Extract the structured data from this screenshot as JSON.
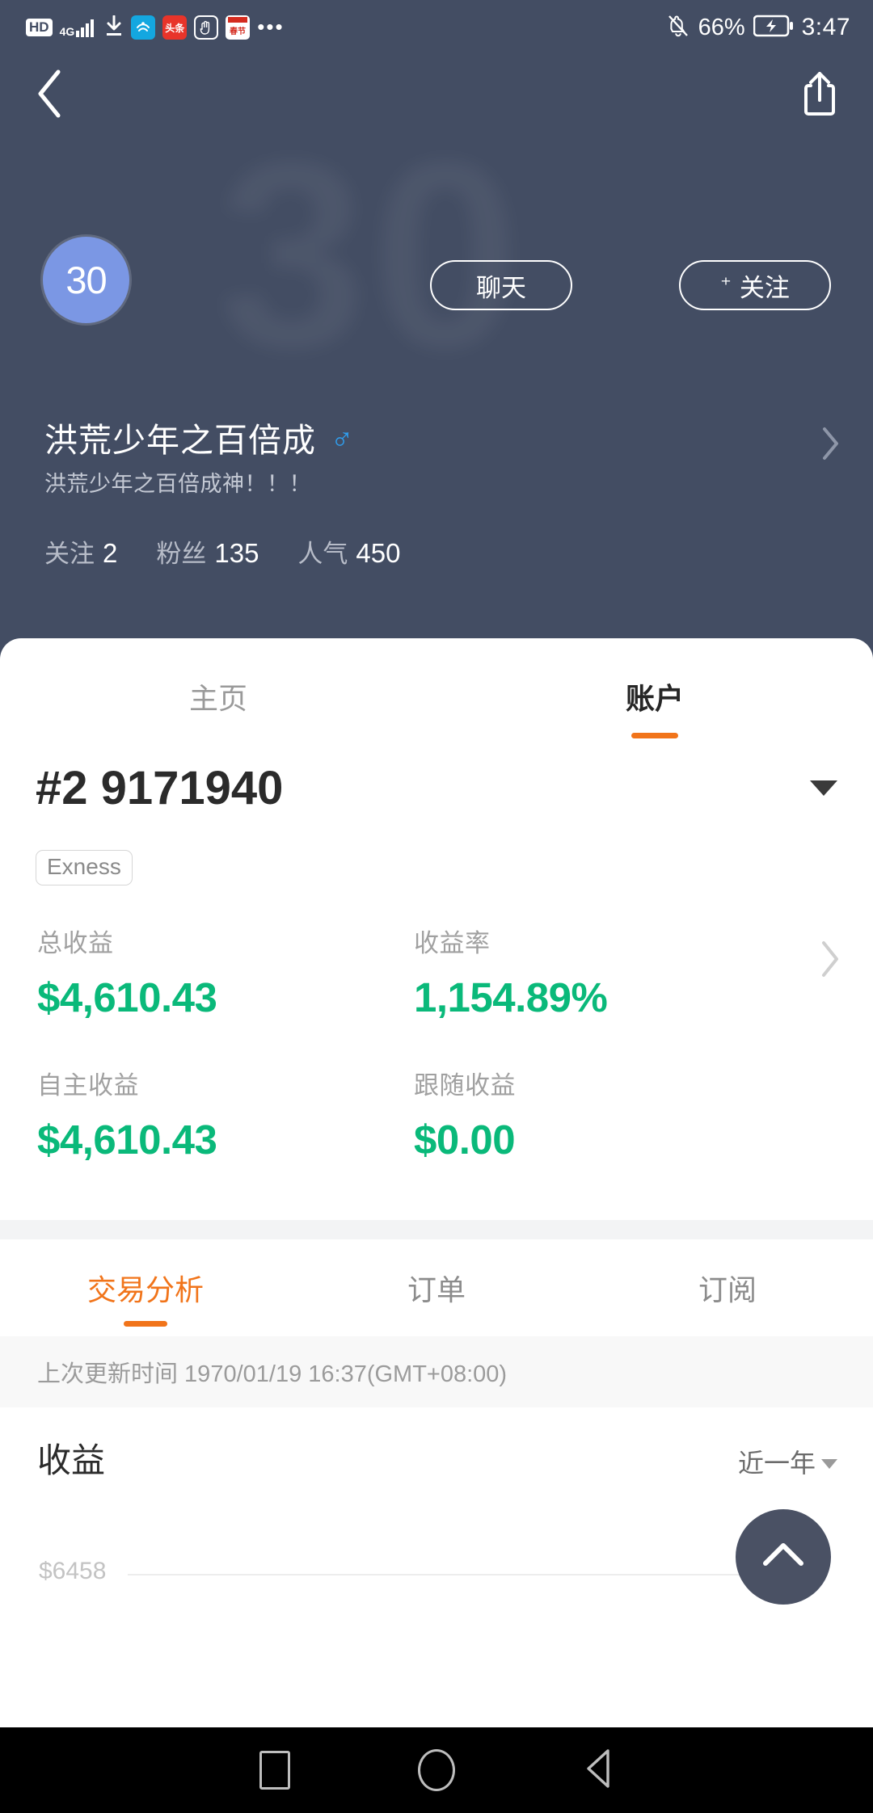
{
  "status_bar": {
    "hd_badge": "HD",
    "network": "4G",
    "icons": [
      "hd-badge",
      "signal-4g-icon",
      "download-icon",
      "app-alipay-icon",
      "app-toutiao-icon",
      "app-gesture-icon",
      "app-calendar-icon",
      "more-icon"
    ],
    "more": "•••",
    "mute_icon": "bell-muted-icon",
    "battery_percent": "66%",
    "battery_icon": "battery-charging-icon",
    "time": "3:47"
  },
  "topnav": {
    "back_icon": "back-chevron-icon",
    "share_icon": "share-icon"
  },
  "profile": {
    "avatar_label": "30",
    "watermark": "30",
    "chat_button": "聊天",
    "follow_button": "关注",
    "follow_plus": "⁺",
    "display_name": "洪荒少年之百倍成",
    "gender_icon": "♂",
    "bio": "洪荒少年之百倍成神！！！",
    "stats": [
      {
        "label": "关注",
        "value": "2"
      },
      {
        "label": "粉丝",
        "value": "135"
      },
      {
        "label": "人气",
        "value": "450"
      }
    ]
  },
  "profile_tabs": [
    {
      "label": "主页",
      "active": false
    },
    {
      "label": "账户",
      "active": true
    }
  ],
  "account": {
    "number": "#2 9171940",
    "dropdown_icon": "chevron-down-icon",
    "broker_badge": "Exness",
    "detail_chevron_icon": "chevron-right-icon",
    "metrics": [
      {
        "label": "总收益",
        "value": "$4,610.43"
      },
      {
        "label": "收益率",
        "value": "1,154.89%"
      },
      {
        "label": "自主收益",
        "value": "$4,610.43"
      },
      {
        "label": "跟随收益",
        "value": "$0.00"
      }
    ],
    "value_color": "#0ab97a"
  },
  "analysis_tabs": [
    {
      "label": "交易分析",
      "active": true
    },
    {
      "label": "订单",
      "active": false
    },
    {
      "label": "订阅",
      "active": false
    }
  ],
  "update_time": "上次更新时间 1970/01/19 16:37(GMT+08:00)",
  "chart_section": {
    "title": "收益",
    "range_label": "近一年",
    "range_icon": "chevron-down-icon",
    "top_axis_label": "$6458"
  },
  "fab": {
    "icon": "chevron-up-icon"
  },
  "navbar": {
    "recents_icon": "square-icon",
    "home_icon": "circle-icon",
    "back_icon": "triangle-back-icon"
  },
  "colors": {
    "hero_bg": "#434d63",
    "accent": "#f1741a",
    "profit_green": "#0ab97a",
    "avatar_blue": "#7b97e4",
    "gender_blue": "#2f9ff0"
  },
  "chart_data": {
    "type": "line",
    "title": "收益",
    "range": "近一年",
    "x": [],
    "values": [],
    "ylabel": "",
    "xlabel": "",
    "ytick_labels": [
      "$6458"
    ],
    "ylim": [
      0,
      6458
    ],
    "grid": true,
    "legend": "none",
    "note": "chart body is cut off below the viewport; only the top gridline label $6458 is visible"
  }
}
